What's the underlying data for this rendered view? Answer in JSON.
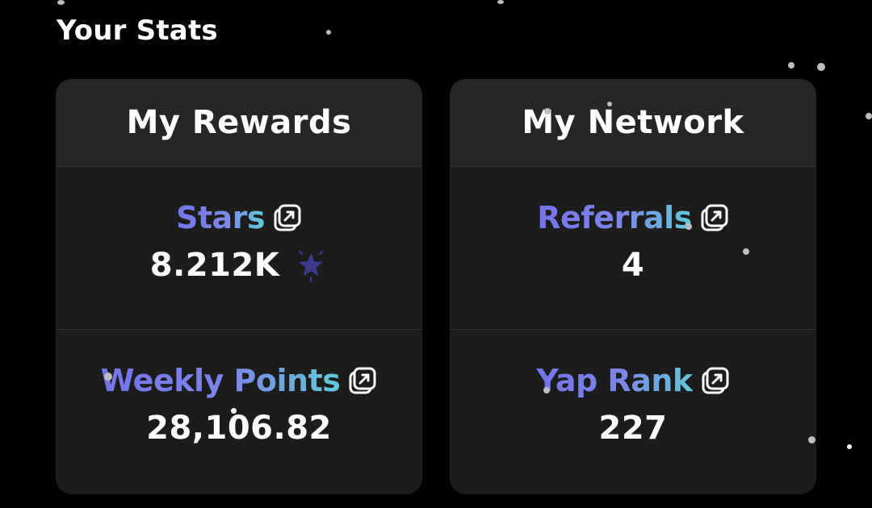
{
  "section": {
    "title": "Your Stats"
  },
  "cards": [
    {
      "title": "My Rewards",
      "stats": [
        {
          "label": "Stars",
          "value": "8.212K",
          "icon": "star-icon"
        },
        {
          "label": "Weekly Points",
          "value": "28,106.82"
        }
      ]
    },
    {
      "title": "My Network",
      "stats": [
        {
          "label": "Referrals",
          "value": "4"
        },
        {
          "label": "Yap Rank",
          "value": "227"
        }
      ]
    }
  ],
  "icons": {
    "external_link": "external-link-icon",
    "star": "star-icon"
  },
  "colors": {
    "background": "#000000",
    "card": "#1c1c1d",
    "card_header": "#262627",
    "label_gradient_start": "#7473ea",
    "label_gradient_end": "#5fcad7",
    "star": "#3d3a8c"
  }
}
